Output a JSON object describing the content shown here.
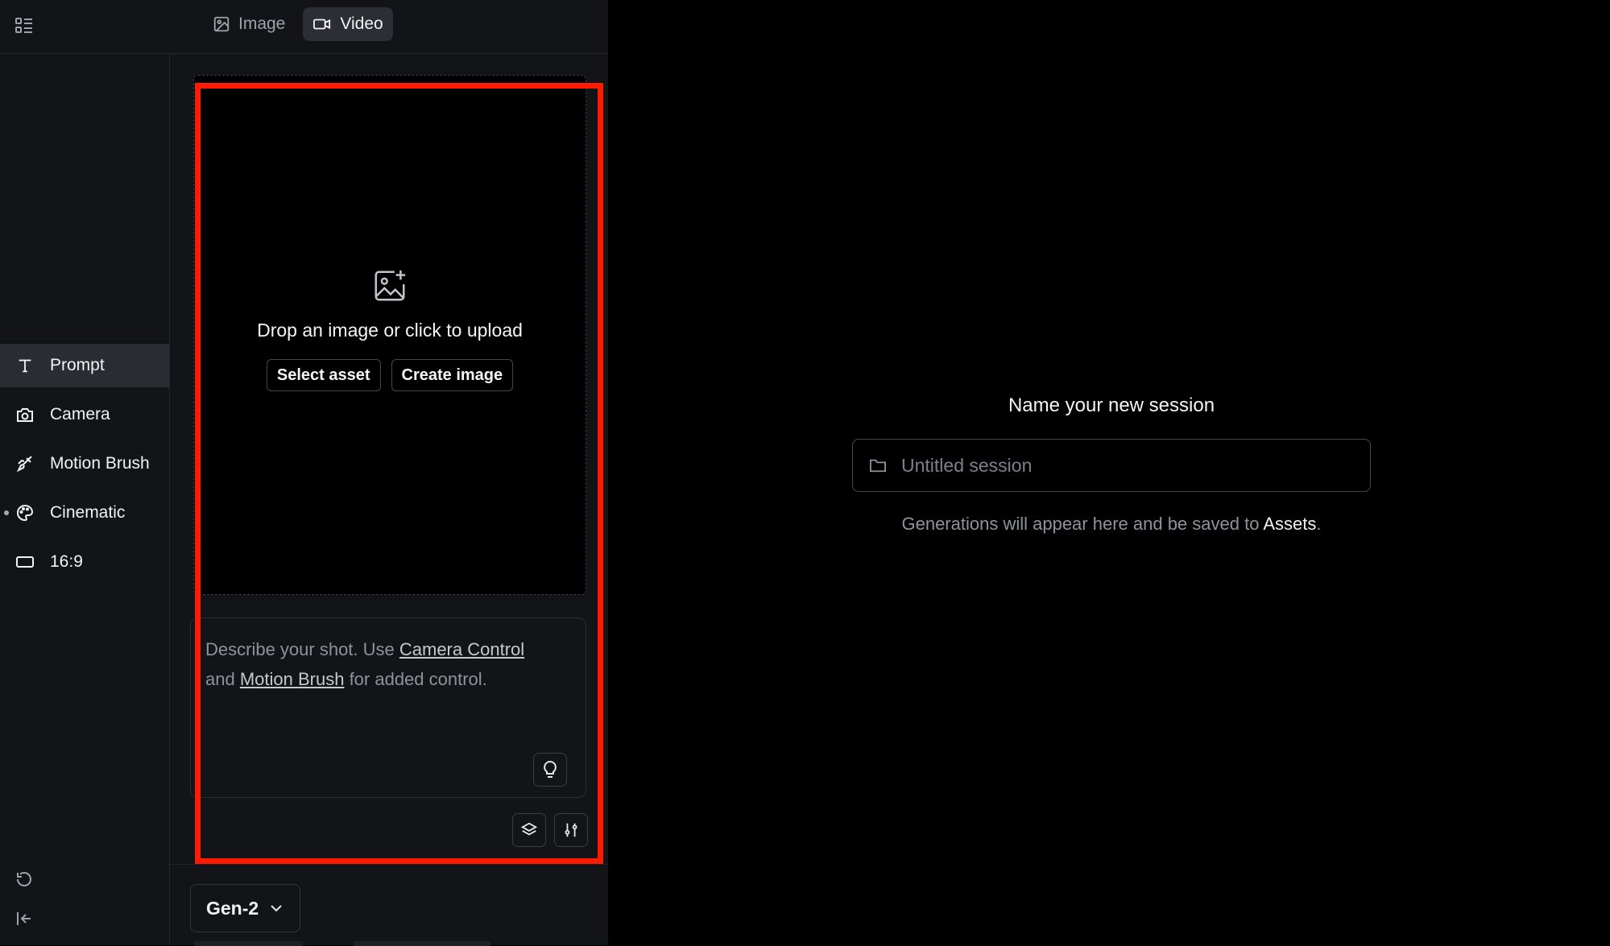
{
  "header": {
    "tabs": [
      {
        "label": "Image",
        "icon": "image-icon",
        "active": false
      },
      {
        "label": "Video",
        "icon": "video-icon",
        "active": true
      }
    ]
  },
  "sidebar": {
    "items": [
      {
        "label": "Prompt",
        "icon": "text-icon",
        "active": true
      },
      {
        "label": "Camera",
        "icon": "camera-icon",
        "active": false
      },
      {
        "label": "Motion Brush",
        "icon": "brush-icon",
        "active": false
      },
      {
        "label": "Cinematic",
        "icon": "palette-icon",
        "active": false,
        "dot": true
      },
      {
        "label": "16:9",
        "icon": "aspect-ratio-icon",
        "active": false
      }
    ]
  },
  "upload": {
    "title": "Drop an image or click to upload",
    "select_label": "Select asset",
    "create_label": "Create image"
  },
  "prompt": {
    "text_before": "Describe your shot. Use ",
    "camera_link": "Camera Control",
    "text_middle": " and ",
    "brush_link": "Motion Brush",
    "text_after": " for added control."
  },
  "model": {
    "selected": "Gen-2"
  },
  "session": {
    "title": "Name your new session",
    "placeholder": "Untitled session",
    "note_before": "Generations will appear here and be saved to ",
    "note_link": "Assets",
    "note_after": "."
  },
  "colors": {
    "highlight": "#ff1a00",
    "panel": "#131418",
    "canvas": "#000000"
  }
}
